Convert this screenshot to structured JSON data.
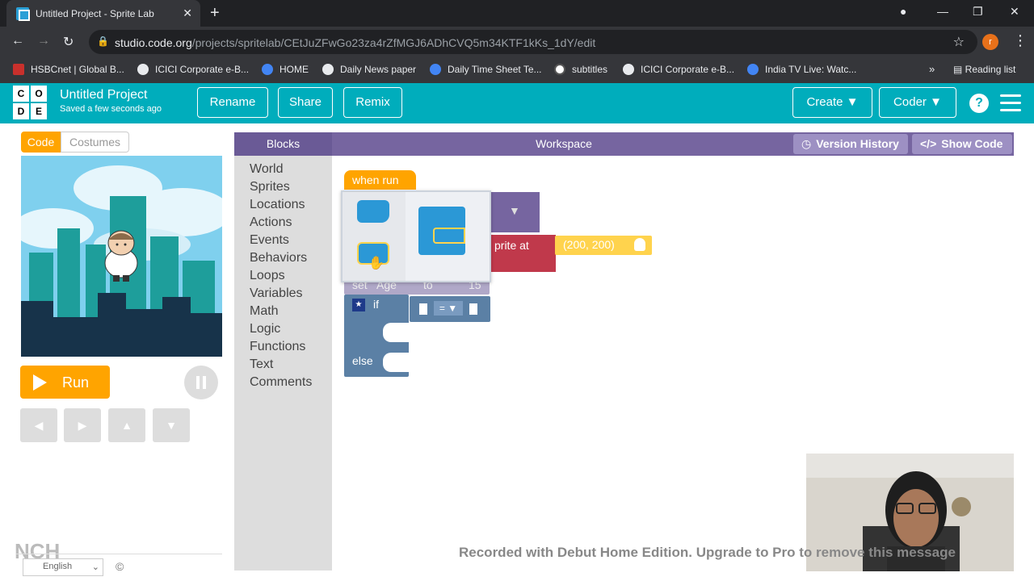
{
  "browser": {
    "tab_title": "Untitled Project - Sprite Lab",
    "tab_close": "✕",
    "new_tab": "+",
    "url_host": "studio.code.org",
    "url_path": "/projects/spritelab/CEtJuZFwGo23za4rZfMGJ6ADhCVQ5m34KTF1kKs_1dY/edit",
    "profile_initial": "r",
    "bookmarks": [
      "HSBCnet | Global B...",
      "ICICI Corporate e-B...",
      "HOME",
      "Daily News paper",
      "Daily Time Sheet Te...",
      "subtitles",
      "ICICI Corporate e-B...",
      "India TV Live: Watc..."
    ],
    "bookmarks_more": "»",
    "reading_list": "Reading list"
  },
  "header": {
    "logo_letters": [
      "C",
      "O",
      "D",
      "E"
    ],
    "project_title": "Untitled Project",
    "saved_status": "Saved a few seconds ago",
    "rename": "Rename",
    "share": "Share",
    "remix": "Remix",
    "create": "Create",
    "coder": "Coder",
    "help": "?"
  },
  "left": {
    "tab_code": "Code",
    "tab_costumes": "Costumes",
    "run": "Run",
    "language": "English",
    "copyright": "©",
    "brand": "NCH"
  },
  "workspace_header": {
    "blocks": "Blocks",
    "workspace": "Workspace",
    "version_history": "Version History",
    "show_code": "Show Code"
  },
  "toolbox": {
    "categories": [
      "World",
      "Sprites",
      "Locations",
      "Actions",
      "Events",
      "Behaviors",
      "Loops",
      "Variables",
      "Math",
      "Logic",
      "Functions",
      "Text",
      "Comments"
    ]
  },
  "blocks": {
    "when_run": "when run",
    "sprite_at": "prite at",
    "coords": "(200, 200)",
    "set_var": "set",
    "var_name": "Age",
    "to": "to",
    "value": "15",
    "if": "if",
    "else": "else",
    "op": "=",
    "dropdown_arrow": "▼"
  },
  "watermark": "Recorded with Debut Home Edition. Upgrade to Pro to remove this message",
  "colors": {
    "header": "#00adbc",
    "workspace_header": "#7665a0",
    "orange": "#ffa400",
    "logic_blue": "#5b80a5",
    "sprite_red": "#c0394b",
    "yellow": "#ffd34d"
  }
}
